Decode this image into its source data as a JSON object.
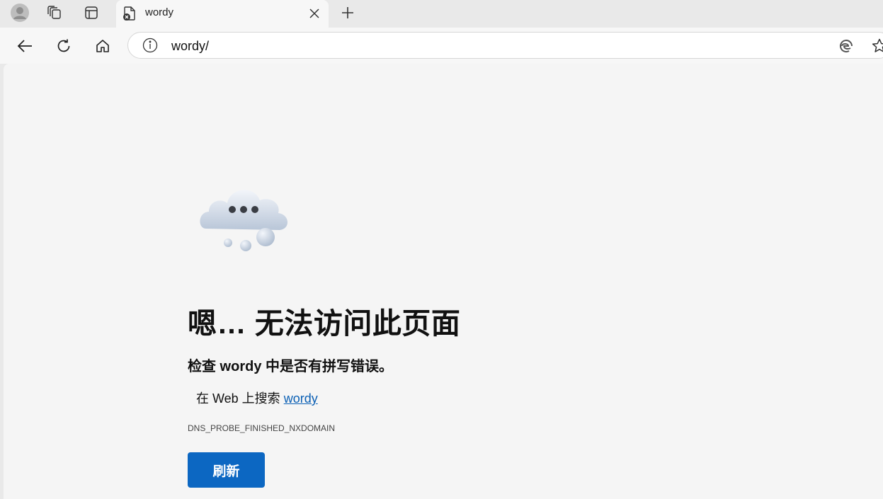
{
  "tab": {
    "title": "wordy"
  },
  "omnibox": {
    "url": "wordy/"
  },
  "error": {
    "heading": "嗯… 无法访问此页面",
    "check_text": "检查 wordy 中是否有拼写错误。",
    "search_prefix": "在 Web 上搜索 ",
    "search_link": "wordy",
    "code": "DNS_PROBE_FINISHED_NXDOMAIN",
    "refresh_label": "刷新"
  },
  "colors": {
    "accent": "#0c67c2",
    "link": "#0a5fb4",
    "page_bg": "#f5f5f5",
    "chrome_bg": "#e9e9e9"
  },
  "icons": {
    "tabstrip": [
      "avatar-icon",
      "workspaces-icon",
      "tab-actions-icon"
    ],
    "tab": [
      "page-error-icon",
      "close-icon"
    ],
    "newtab": "plus-icon",
    "toolbar": [
      "back-arrow-icon",
      "refresh-icon",
      "home-icon"
    ],
    "omnibox": [
      "info-icon",
      "edge-read-aloud-icon",
      "favorite-star-icon"
    ],
    "illustration": "cloud-thinking-icon"
  }
}
